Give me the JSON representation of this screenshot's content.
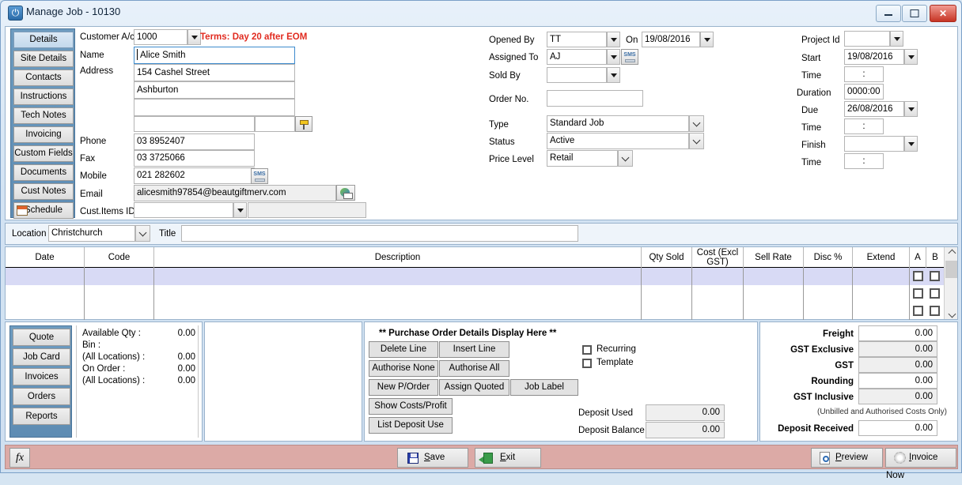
{
  "window": {
    "title": "Manage Job - 10130",
    "icon": "power-icon",
    "controls": {
      "minimize": "minimize-icon",
      "maximize": "maximize-icon",
      "close": "✕"
    }
  },
  "tabs": [
    {
      "label": "Details",
      "active": true
    },
    {
      "label": "Site Details",
      "active": false
    },
    {
      "label": "Contacts",
      "active": false
    },
    {
      "label": "Instructions",
      "active": false
    },
    {
      "label": "Tech Notes",
      "active": false
    },
    {
      "label": "Invoicing",
      "active": false
    },
    {
      "label": "Custom Fields",
      "active": false
    },
    {
      "label": "Documents",
      "active": false
    },
    {
      "label": "Cust Notes",
      "active": false
    },
    {
      "label": "Schedule",
      "active": false,
      "icon": "calendar-icon"
    }
  ],
  "customer": {
    "account_label": "Customer A/c",
    "account_value": "1000",
    "terms": "Terms: Day 20 after EOM",
    "name_label": "Name",
    "name_value": "Alice Smith",
    "address_label": "Address",
    "address_1": "154 Cashel Street",
    "address_2": "Ashburton",
    "address_3": "",
    "address_4": "",
    "address_5": "",
    "phone_label": "Phone",
    "phone_value": "03 8952407",
    "fax_label": "Fax",
    "fax_value": "03 3725066",
    "mobile_label": "Mobile",
    "mobile_value": "021 282602",
    "email_label": "Email",
    "email_value": "alicesmith97854@beautgiftmerv.com",
    "cust_items_label": "Cust.Items ID",
    "cust_items_value": "",
    "cust_items_desc": ""
  },
  "job": {
    "opened_by_label": "Opened By",
    "opened_by_value": "TT",
    "on_label": "On",
    "on_value": "19/08/2016",
    "assigned_to_label": "Assigned To",
    "assigned_to_value": "AJ",
    "sold_by_label": "Sold By",
    "sold_by_value": "",
    "order_no_label": "Order No.",
    "order_no_value": "",
    "type_label": "Type",
    "type_value": "Standard Job",
    "status_label": "Status",
    "status_value": "Active",
    "price_level_label": "Price Level",
    "price_level_value": "Retail"
  },
  "schedule": {
    "project_id_label": "Project Id",
    "project_id_value": "",
    "start_label": "Start",
    "start_value": "19/08/2016",
    "start_time_label": "Time",
    "start_time_value": ":",
    "duration_label": "Duration",
    "duration_value": "0000:00",
    "due_label": "Due",
    "due_value": "26/08/2016",
    "due_time_label": "Time",
    "due_time_value": ":",
    "finish_label": "Finish",
    "finish_value": "",
    "finish_time_label": "Time",
    "finish_time_value": ":"
  },
  "location_bar": {
    "location_label": "Location",
    "location_value": "Christchurch",
    "title_label": "Title",
    "title_value": ""
  },
  "grid": {
    "columns": [
      {
        "label": "Date"
      },
      {
        "label": "Code"
      },
      {
        "label": "Description"
      },
      {
        "label": "Qty Sold"
      },
      {
        "label": "Cost    (Excl",
        "label2": "GST)"
      },
      {
        "label": "Sell Rate"
      },
      {
        "label": "Disc %"
      },
      {
        "label": "Extend"
      },
      {
        "label": "A"
      },
      {
        "label": "B"
      }
    ],
    "rows": [
      {
        "selected": true
      },
      {
        "selected": false
      },
      {
        "selected": false
      }
    ]
  },
  "stock": {
    "buttons": [
      "Quote",
      "Job Card",
      "Invoices",
      "Orders",
      "Reports"
    ],
    "lines": [
      {
        "label": "Available Qty :",
        "value": "0.00"
      },
      {
        "label": "Bin :",
        "value": ""
      },
      {
        "label": "(All Locations) :",
        "value": "0.00"
      },
      {
        "label": "On Order :",
        "value": "0.00"
      },
      {
        "label": "(All Locations) :",
        "value": "0.00"
      }
    ]
  },
  "purchase_order": {
    "header": "** Purchase Order Details Display Here **",
    "buttons": [
      "Delete Line",
      "Insert Line",
      "Authorise None",
      "Authorise All",
      "New P/Order",
      "Assign Quoted",
      "Job Label",
      "Show Costs/Profit",
      "List Deposit Use"
    ],
    "checkboxes": [
      {
        "label": "Recurring",
        "checked": false
      },
      {
        "label": "Template",
        "checked": false
      }
    ],
    "deposit_used_label": "Deposit Used",
    "deposit_used_value": "0.00",
    "deposit_balance_label": "Deposit Balance",
    "deposit_balance_value": "0.00"
  },
  "totals": {
    "rows": [
      {
        "label": "Freight",
        "value": "0.00",
        "readonly": false
      },
      {
        "label": "GST Exclusive",
        "value": "0.00",
        "readonly": true
      },
      {
        "label": "GST",
        "value": "0.00",
        "readonly": true
      },
      {
        "label": "Rounding",
        "value": "0.00",
        "readonly": false
      },
      {
        "label": "GST Inclusive",
        "value": "0.00",
        "readonly": true
      }
    ],
    "note": "(Unbilled and Authorised Costs Only)",
    "deposit_received_label": "Deposit Received",
    "deposit_received_value": "0.00"
  },
  "statusbar": {
    "fx_label": "fx",
    "save_label": "Save",
    "exit_label": "Exit",
    "preview_label": "Preview",
    "invoice_now_label": "Invoice Now"
  },
  "colors": {
    "accent": "#5e8cb3",
    "terms_red": "#e12b20",
    "selected_row": "#d8daf5",
    "statusbar": "#dcaaa6"
  }
}
